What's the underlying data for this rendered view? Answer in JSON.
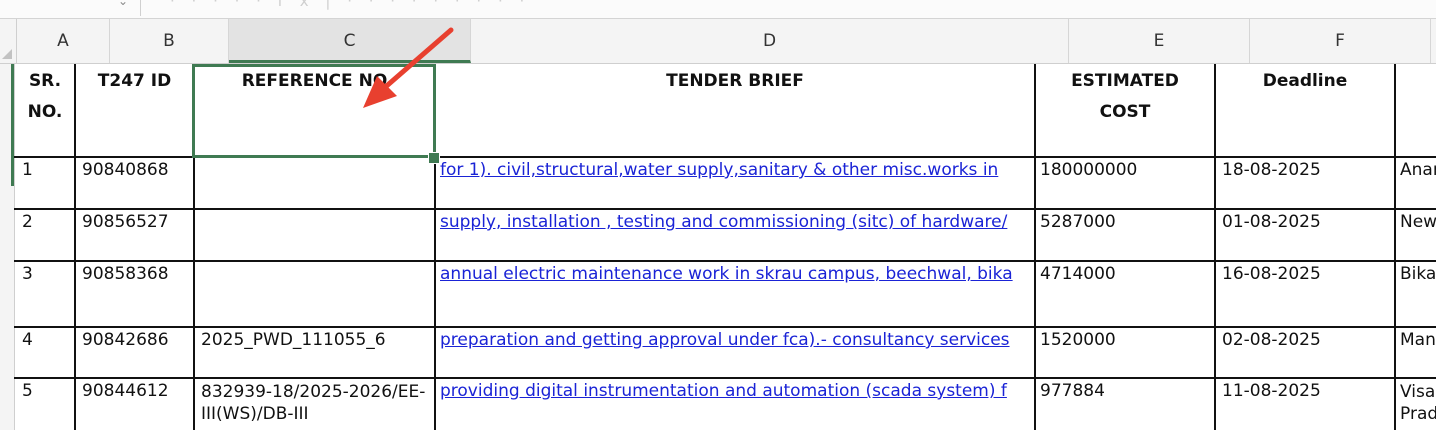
{
  "columns": [
    "A",
    "B",
    "C",
    "D",
    "E",
    "F"
  ],
  "headers": {
    "sr_no": "SR. NO.",
    "t247_id": "T247 ID",
    "reference_no": "REFERENCE NO",
    "tender_brief": "TENDER BRIEF",
    "estimated_cost": "ESTIMATED COST",
    "deadline": "Deadline"
  },
  "rows": [
    {
      "sr": "1",
      "id": "90840868",
      "ref": "",
      "brief": "for 1). civil,structural,water supply,sanitary & other misc.works in",
      "cost": "180000000",
      "deadline": "18-08-2025",
      "extra": "Anan"
    },
    {
      "sr": "2",
      "id": "90856527",
      "ref": "",
      "brief": "supply, installation , testing and commissioning (sitc) of hardware/",
      "cost": "5287000",
      "deadline": "01-08-2025",
      "extra": "New"
    },
    {
      "sr": "3",
      "id": "90858368",
      "ref": "",
      "brief": "annual electric maintenance work in skrau campus, beechwal, bika",
      "cost": "4714000",
      "deadline": "16-08-2025",
      "extra": "Bika"
    },
    {
      "sr": "4",
      "id": "90842686",
      "ref": "2025_PWD_111055_6",
      "brief": "preparation and getting approval under fca).- consultancy services",
      "cost": "1520000",
      "deadline": "02-08-2025",
      "extra": "Man"
    },
    {
      "sr": "5",
      "id": "90844612",
      "ref": "832939-18/2025-2026/EE-III(WS)/DB-III",
      "brief": "providing digital instrumentation and automation (scada system) f",
      "cost": "977884",
      "deadline": "11-08-2025",
      "extra": "Visa Prad"
    }
  ],
  "colors": {
    "selection": "#3f7a52",
    "link": "#1a23d6",
    "arrow": "#e8402f"
  }
}
